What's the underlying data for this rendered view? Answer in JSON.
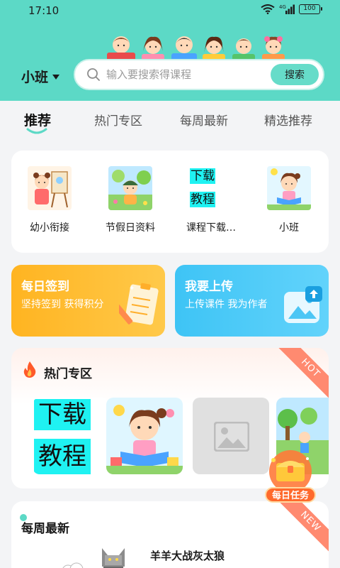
{
  "status_bar": {
    "time": "17:10",
    "network": "4G",
    "battery": "100"
  },
  "header": {
    "grade": "小班",
    "search": {
      "placeholder": "输入要搜索得课程",
      "button_label": "搜索"
    }
  },
  "tabs": [
    {
      "label": "推荐",
      "active": true
    },
    {
      "label": "热门专区",
      "active": false
    },
    {
      "label": "每周最新",
      "active": false
    },
    {
      "label": "精选推荐",
      "active": false
    }
  ],
  "categories": [
    {
      "label": "幼小衔接",
      "icon": "child-painting-icon"
    },
    {
      "label": "节假日资料",
      "icon": "kid-outdoor-icon"
    },
    {
      "label": "课程下载…",
      "icon": "download-tutorial-icon",
      "thumb_text": [
        "下载",
        "教程"
      ]
    },
    {
      "label": "小班",
      "icon": "girl-reading-icon"
    }
  ],
  "promos": {
    "signin": {
      "title": "每日签到",
      "subtitle": "坚持签到 获得积分"
    },
    "upload": {
      "title": "我要上传",
      "subtitle": "上传课件 我为作者"
    }
  },
  "hot_section": {
    "title": "热门专区",
    "badge": "HOT",
    "items": [
      {
        "type": "text-thumb",
        "lines": [
          "下载",
          "教程"
        ]
      },
      {
        "type": "illustration",
        "icon": "girl-reading-icon"
      },
      {
        "type": "placeholder",
        "icon": "image-placeholder-icon"
      },
      {
        "type": "illustration",
        "icon": "park-scene-icon"
      }
    ]
  },
  "new_section": {
    "title": "每周最新",
    "badge": "NEW",
    "first_item_title": "羊羊大战灰太狼"
  },
  "daily_task": {
    "label": "每日任务"
  },
  "colors": {
    "header": "#5cd9c6",
    "search_button": "#66dcc9",
    "signin_card": "#ffb421",
    "upload_card": "#3ec4f5",
    "hot_ribbon": "#ff8a70",
    "new_ribbon": "#ff8a70",
    "thumb_cyan": "#1ff2f2"
  }
}
